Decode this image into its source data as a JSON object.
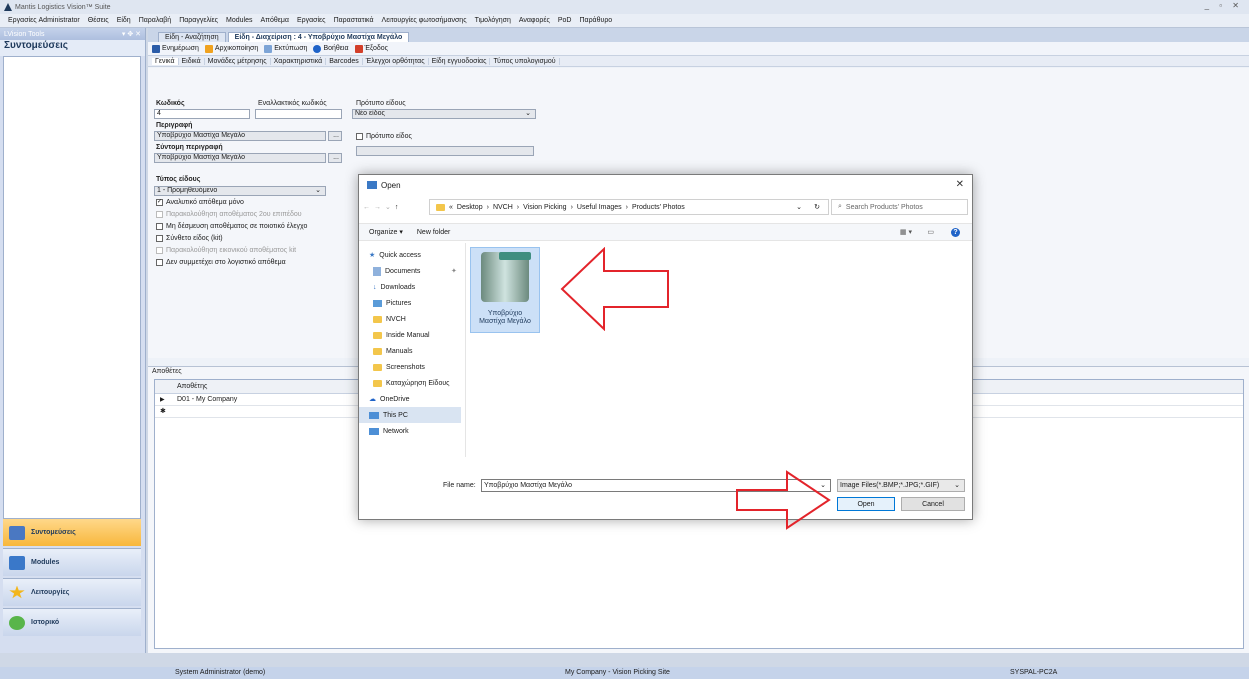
{
  "app": {
    "title": "Mantis Logistics Vision™ Suite"
  },
  "menu": [
    "Εργασίες Administrator",
    "Θέσεις",
    "Είδη",
    "Παραλαβή",
    "Παραγγελίες",
    "Modules",
    "Απόθεμα",
    "Εργασίες",
    "Παραστατικά",
    "Λειτουργίες φωτοσήμανσης",
    "Τιμολόγηση",
    "Αναφορές",
    "PoD",
    "Παράθυρο"
  ],
  "left_panel": {
    "header": "LVision Tools",
    "title": "Συντομεύσεις",
    "nav": [
      "Συντομεύσεις",
      "Modules",
      "Λειτουργίες",
      "Ιστορικό"
    ]
  },
  "tabs": [
    "Είδη - Αναζήτηση",
    "Είδη - Διαχείριση : 4 - Υποβρύχιο Μαστίχα Μεγάλο"
  ],
  "toolbar": [
    "Ενημέρωση",
    "Αρχικοποίηση",
    "Εκτύπωση",
    "Βοήθεια",
    "Έξοδος"
  ],
  "subtabs": [
    "Γενικά",
    "Ειδικά",
    "Μονάδες μέτρησης",
    "Χαρακτηριστικά",
    "Barcodes",
    "Έλεγχοι ορθότητας",
    "Είδη εγγυοδοσίας",
    "Τύπος υπολογισμού"
  ],
  "form": {
    "code_label": "Κωδικός",
    "code_value": "4",
    "alt_code_label": "Εναλλακτικός κωδικός",
    "template_label": "Πρότυπο είδους",
    "template_value": "Νέο είδος",
    "desc_label": "Περιγραφή",
    "desc_value": "Υποβρύχιο Μαστίχα Μεγάλο",
    "short_desc_label": "Σύντομη περιγραφή",
    "short_desc_value": "Υποβρύχιο Μαστίχα Μεγάλο",
    "template_chk": "Πρότυπο είδος",
    "type_label": "Τύπος είδους",
    "type_value": "1 - Προμηθευόμενο",
    "checks": [
      "Αναλυτικό απόθεμα μόνο",
      "Παρακολούθηση αποθέματος 2ου επιπέδου",
      "Μη δέσμευση αποθέματος σε ποιοτικό έλεγχο",
      "Σύνθετο είδος (kit)",
      "Παρακολούθηση εικονικού αποθέματος kit",
      "Δεν συμμετέχει στο λογιστικό απόθεμα"
    ]
  },
  "apothetes": {
    "section": "Αποθέτες",
    "column": "Αποθέτης",
    "row": "D01 - My Company"
  },
  "statusbar": {
    "user": "System Administrator (demo)",
    "site": "My Company - Vision Picking Site",
    "machine": "SYSPAL-PC2A"
  },
  "dialog": {
    "title": "Open",
    "path": [
      "«",
      "Desktop",
      "NVCH",
      "Vision Picking",
      "Useful Images",
      "Products' Photos"
    ],
    "search_placeholder": "Search Products' Photos",
    "organize": "Organize ▾",
    "new_folder": "New folder",
    "nav": {
      "quick_access": "Quick access",
      "items": [
        "Documents",
        "Downloads",
        "Pictures",
        "NVCH",
        "Inside Manual",
        "Manuals",
        "Screenshots",
        "Καταχώρηση Είδους"
      ],
      "onedrive": "OneDrive",
      "thispc": "This PC",
      "network": "Network"
    },
    "file_label_1": "Υποβρύχιο",
    "file_label_2": "Μαστίχα Μεγάλο",
    "filename_label": "File name:",
    "filename_value": "Υποβρύχιο Μαστίχα Μεγάλο",
    "filter": "Image Files(*.BMP;*.JPG;*.GIF)",
    "open": "Open",
    "cancel": "Cancel"
  }
}
